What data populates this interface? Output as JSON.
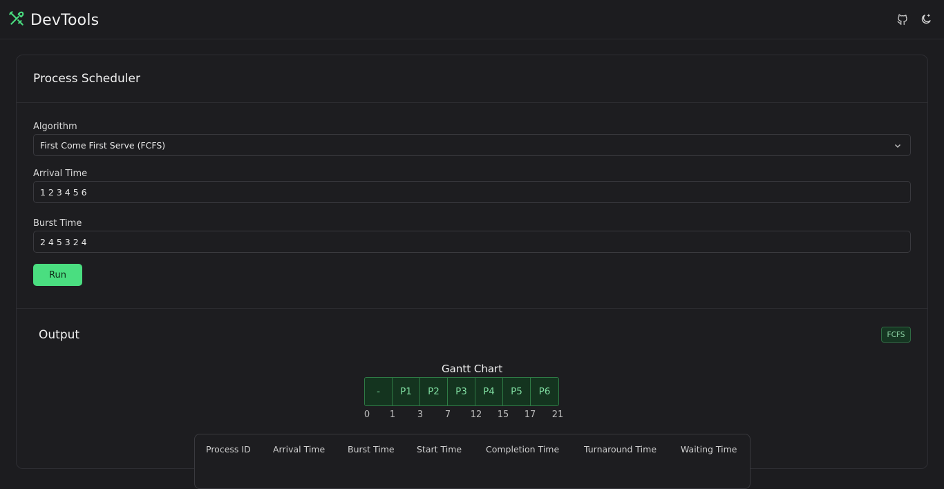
{
  "app": {
    "title": "DevTools",
    "accent": "#4ade80"
  },
  "header": {
    "icons": [
      "github-icon",
      "theme-toggle-icon"
    ]
  },
  "scheduler": {
    "title": "Process Scheduler",
    "algorithm_label": "Algorithm",
    "algorithm_value": "First Come First Serve (FCFS)",
    "arrival_label": "Arrival Time",
    "arrival_value": "1 2 3 4 5 6",
    "burst_label": "Burst Time",
    "burst_value": "2 4 5 3 2 4",
    "run_label": "Run"
  },
  "output": {
    "title": "Output",
    "badge": "FCFS",
    "gantt_title": "Gantt Chart",
    "gantt_cells": [
      "-",
      "P1",
      "P2",
      "P3",
      "P4",
      "P5",
      "P6"
    ],
    "gantt_times": [
      "0",
      "1",
      "3",
      "7",
      "12",
      "15",
      "17",
      "21"
    ],
    "table_headers": [
      "Process ID",
      "Arrival Time",
      "Burst Time",
      "Start Time",
      "Completion Time",
      "Turnaround Time",
      "Waiting Time"
    ]
  }
}
